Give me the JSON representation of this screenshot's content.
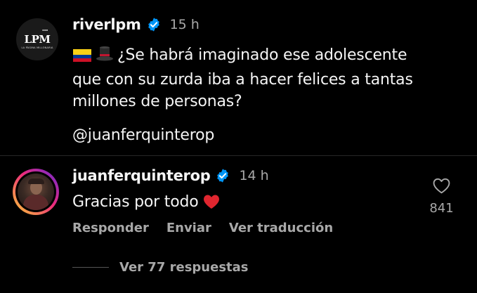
{
  "post": {
    "avatar_logo": "LPM",
    "avatar_logo_subtitle": "LA PÁGINA MILLONARIA",
    "username": "riverlpm",
    "time": "15 h",
    "text_line_1": "¿Se habrá imaginado ese adolescente",
    "text_line_2": "que con su zurda iba a hacer felices a tantas",
    "text_line_3": "millones de personas?",
    "mention": "@juanferquinterop",
    "icons": {
      "flag": "colombia-flag-icon",
      "hat": "top-hat-icon",
      "verified": "verified-badge-icon"
    }
  },
  "reply": {
    "username": "juanferquinterop",
    "time": "14 h",
    "text": "Gracias por todo",
    "emoji": "red-heart-icon",
    "actions": {
      "reply": "Responder",
      "send": "Enviar",
      "translate": "Ver traducción"
    },
    "like_count": "841",
    "view_replies": "Ver 77 respuestas"
  },
  "colors": {
    "background": "#000000",
    "primary_text": "#f5f5f5",
    "secondary_text": "#a8a8a8",
    "verified_blue": "#0095f6",
    "divider": "#262626"
  }
}
